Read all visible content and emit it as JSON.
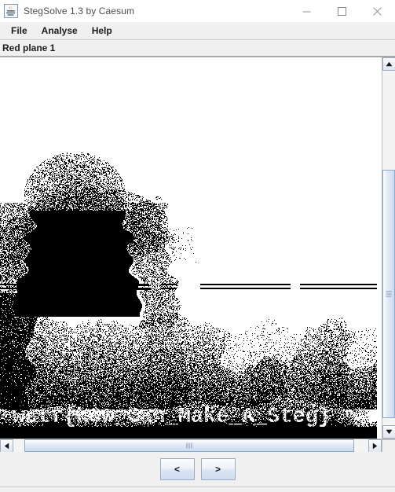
{
  "window": {
    "title": "StegSolve 1.3 by Caesum",
    "app_icon": "java-coffee-cup-icon",
    "controls": {
      "minimize_label": "—",
      "minimize_name": "minimize-icon",
      "maximize_label": "□",
      "maximize_name": "maximize-icon",
      "close_label": "✕",
      "close_name": "close-icon"
    }
  },
  "menubar": {
    "items": [
      {
        "label": "File",
        "name": "menu-file"
      },
      {
        "label": "Analyse",
        "name": "menu-analyse"
      },
      {
        "label": "Help",
        "name": "menu-help"
      }
    ]
  },
  "plane": {
    "label": "Red plane 1"
  },
  "image_view": {
    "description": "binary-bitplane-image",
    "flag_text": "wctf{hOw_Can_Make_A_Steg}",
    "background_color": "#ffffff",
    "foreground_color": "#000000"
  },
  "scrollbars": {
    "vertical": {
      "up_arrow": "▲",
      "down_arrow": "▼",
      "thumb_top_pct": 28,
      "thumb_height_pct": 70
    },
    "horizontal": {
      "left_arrow": "◀",
      "right_arrow": "▶",
      "thumb_left_pct": 3,
      "thumb_width_pct": 93
    }
  },
  "navigation": {
    "prev_label": "<",
    "next_label": ">"
  }
}
